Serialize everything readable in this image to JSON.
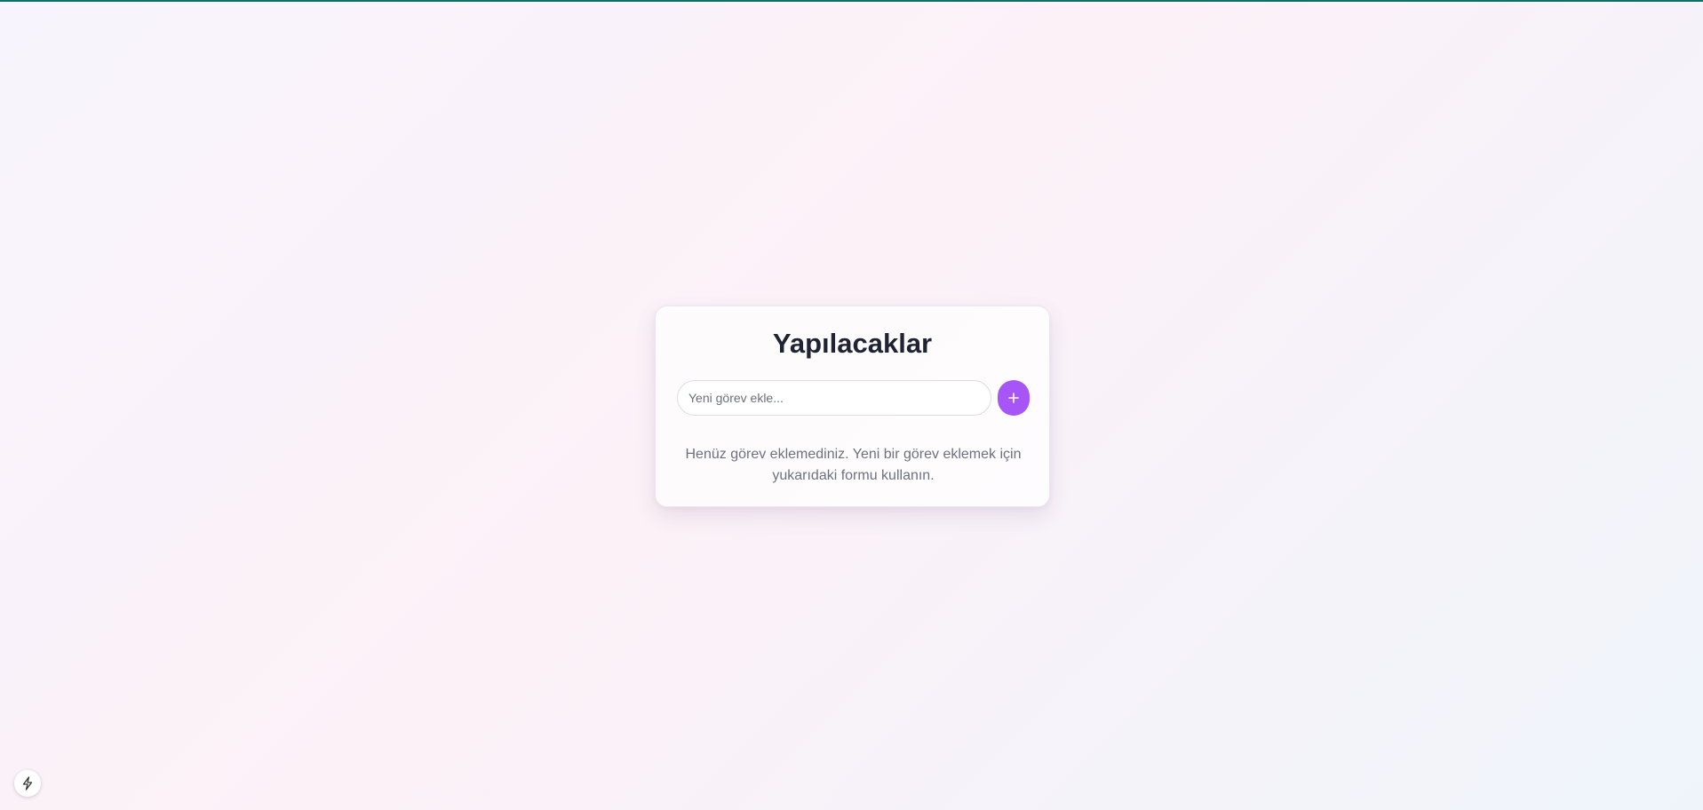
{
  "app": {
    "title": "Yapılacaklar"
  },
  "form": {
    "placeholder": "Yeni görev ekle...",
    "value": "",
    "add_icon": "plus-icon"
  },
  "empty_state": {
    "message": "Henüz görev eklemediniz. Yeni bir görev eklemek için yukarıdaki formu kullanın."
  },
  "corner_button": {
    "icon": "lightning-bolt-icon"
  },
  "colors": {
    "accent": "#a855f7",
    "title": "#1e2433",
    "muted_text": "#6b7280",
    "top_bar": "#0f6e68"
  }
}
